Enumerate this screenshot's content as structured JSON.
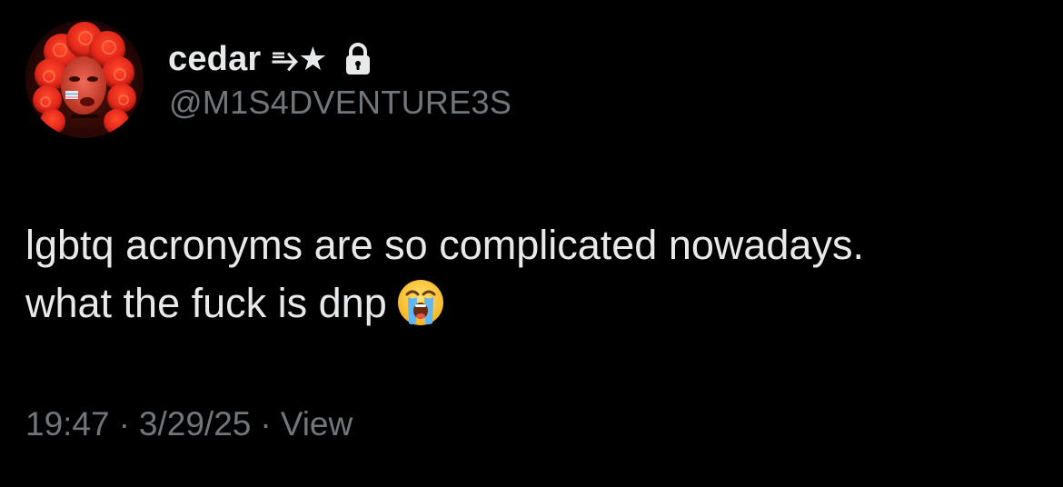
{
  "author": {
    "display_name": "cedar",
    "name_decoration": "⥱★",
    "handle": "@M1S4DVENTURE3S",
    "avatar_icon": "profile-photo",
    "protected_icon": "lock-icon"
  },
  "tweet": {
    "lines": [
      "lgbtq acronyms are so complicated nowadays.",
      "what the fuck is dnp"
    ],
    "emoji": "loudly-crying-face-emoji"
  },
  "meta": {
    "time": "19:47",
    "date": "3/29/25",
    "separator": "·",
    "views_label": "View"
  },
  "colors": {
    "background": "#000000",
    "primary_text": "#e7e9ea",
    "secondary_text": "#71767b"
  }
}
